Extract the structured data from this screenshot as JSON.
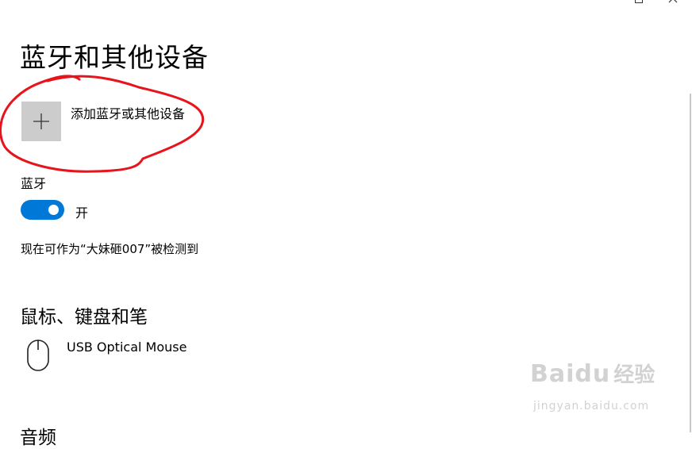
{
  "page": {
    "title": "蓝牙和其他设备",
    "add_device_label": "添加蓝牙或其他设备",
    "bluetooth_label": "蓝牙",
    "bluetooth_state": "开",
    "bluetooth_on": true,
    "discoverable_text": "现在可作为“大妹砸007”被检测到"
  },
  "mouse_section": {
    "title": "鼠标、键盘和笔",
    "devices": [
      {
        "name": "USB Optical Mouse",
        "icon": "mouse-icon"
      }
    ]
  },
  "next_section": {
    "title": "音频"
  },
  "watermark": {
    "brand": "Baidu",
    "brand_cn": "经验",
    "url": "jingyan.baidu.com"
  },
  "colors": {
    "accent": "#0078d7",
    "tile": "#cccccc",
    "annotation": "#e8141c"
  }
}
